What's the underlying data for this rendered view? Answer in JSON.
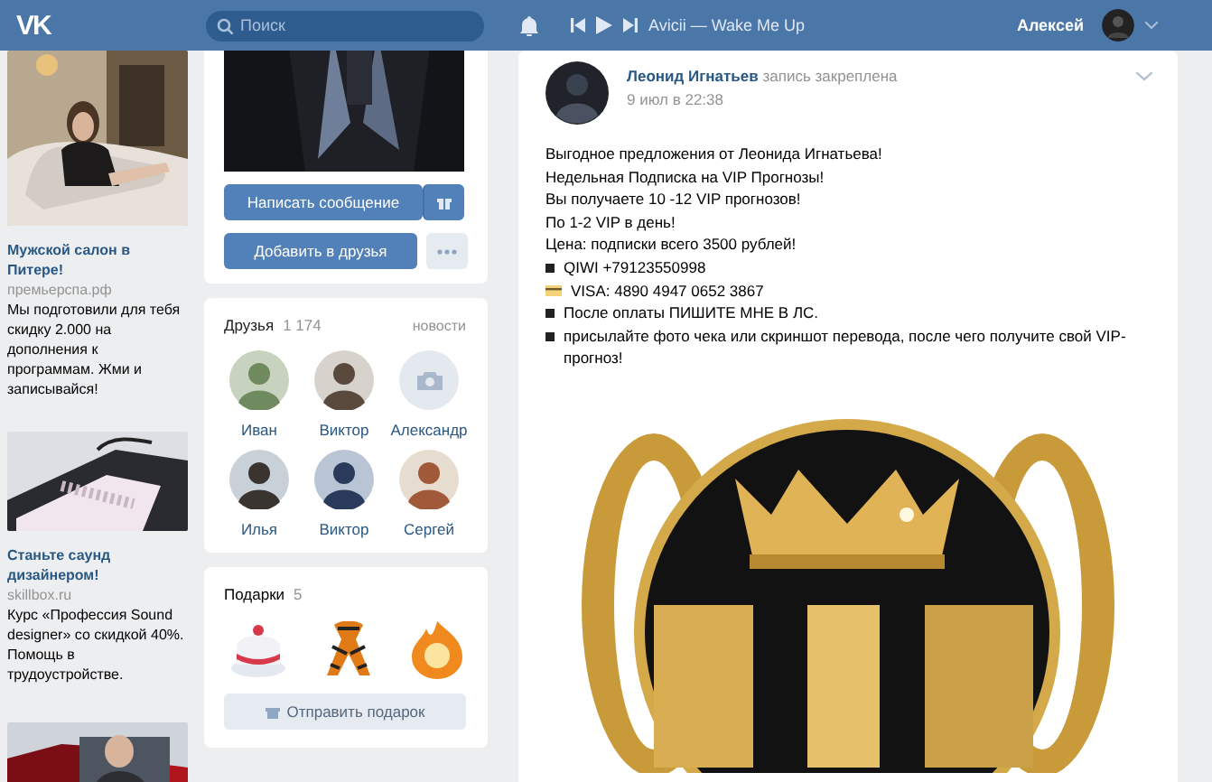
{
  "header": {
    "logo": "VK",
    "search": {
      "placeholder": "Поиск"
    },
    "player": {
      "track": "Avicii — Wake Me Up",
      "playing": false
    },
    "user": {
      "name": "Алексей"
    }
  },
  "ads": [
    {
      "kind": "ad",
      "title": "Мужской салон в Питере!",
      "domain": "премьерспа.рф",
      "text": "Мы подготовили для тебя скидку 2.000 на дополнения к программам. Жми и записывайся!"
    },
    {
      "kind": "ad",
      "title": "Станьте саунд дизайнером!",
      "domain": "skillbox.ru",
      "text": "Курс «Профессия Sound designer» со скидкой 40%. Помощь в трудоустройстве."
    },
    {
      "kind": "picture"
    }
  ],
  "profile": {
    "message_button": "Написать сообщение",
    "add_button": "Добавить в друзья"
  },
  "friends": {
    "title": "Друзья",
    "count": "1 174",
    "link": "новости",
    "items": [
      {
        "name": "Иван",
        "has_photo": true
      },
      {
        "name": "Виктор",
        "has_photo": true
      },
      {
        "name": "Александр",
        "has_photo": false
      },
      {
        "name": "Илья",
        "has_photo": true
      },
      {
        "name": "Виктор",
        "has_photo": true
      },
      {
        "name": "Сергей",
        "has_photo": true
      }
    ]
  },
  "gifts": {
    "title": "Подарки",
    "count": "5",
    "items": [
      {
        "kind": "cake"
      },
      {
        "kind": "ribbon"
      },
      {
        "kind": "flame"
      }
    ],
    "button": "Отправить подарок"
  },
  "post": {
    "author": "Леонид Игнатьев",
    "note": "запись закреплена",
    "date": "9 июл в 22:38",
    "lines": [
      {
        "kind": "text",
        "text": "Выгодное предложения от Леонида Игнатьева!"
      },
      {
        "kind": "text",
        "text": "Недельная Подписка на VIP Прогнозы!"
      },
      {
        "kind": "text",
        "text": "Вы получаете 10 -12 VIP прогнозов!"
      },
      {
        "kind": "text",
        "text": "По 1-2 VIP в день!"
      },
      {
        "kind": "text",
        "text": "Цена: подписки всего 3500 рублей!"
      },
      {
        "kind": "bullet",
        "text": "QIWI +79123550998"
      },
      {
        "kind": "card",
        "text": "VISA: 4890 4947 0652 3867"
      },
      {
        "kind": "bullet",
        "text": "После оплаты ПИШИТЕ МНЕ В ЛС."
      },
      {
        "kind": "bullet",
        "text": "присылайте фото чека или скриншот перевода, после чего получите свой VIP-прогноз!"
      }
    ],
    "image": {
      "kind": "picture"
    }
  }
}
